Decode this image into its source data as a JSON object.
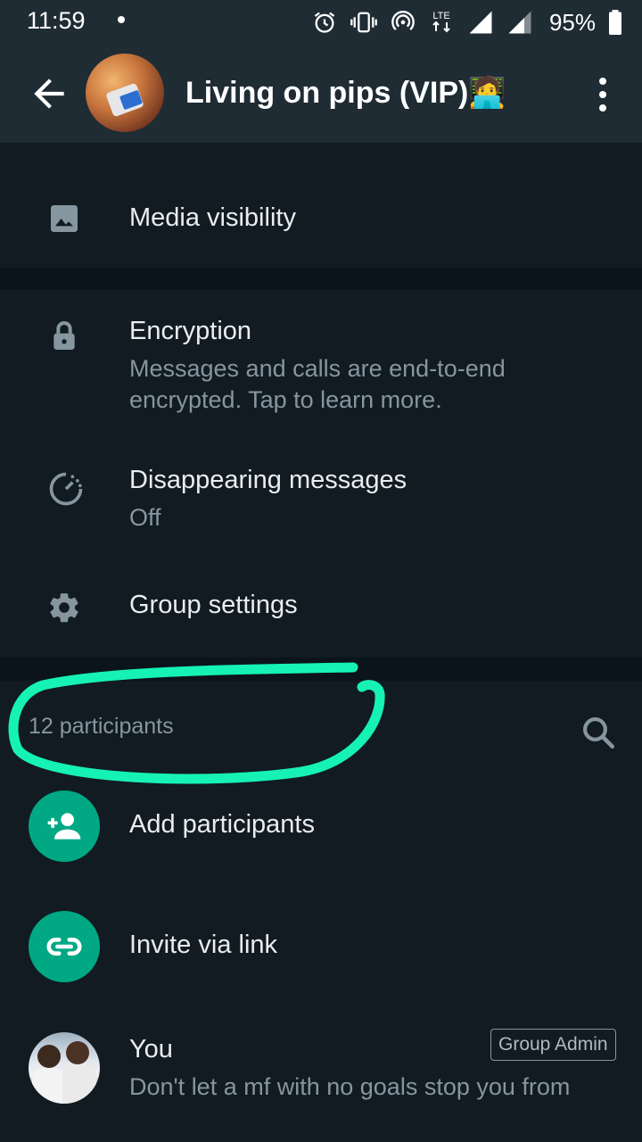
{
  "status_bar": {
    "time": "11:59",
    "network": "LTE",
    "battery": "95%",
    "icons": [
      "notification-dot-icon",
      "alarm-icon",
      "vibrate-icon",
      "hotspot-icon",
      "lte-icon",
      "signal-icon",
      "signal-icon",
      "battery-icon"
    ]
  },
  "header": {
    "title": "Living on pips (VIP)🧑‍💻",
    "back_icon": "back-arrow-icon",
    "menu_icon": "more-vert-icon"
  },
  "settings": {
    "media_visibility": "Media visibility",
    "encryption_title": "Encryption",
    "encryption_sub": "Messages and calls are end-to-end encrypted. Tap to learn more.",
    "disappearing_title": "Disappearing messages",
    "disappearing_sub": "Off",
    "group_settings": "Group settings"
  },
  "participants": {
    "count_label": "12 participants",
    "add_label": "Add participants",
    "invite_label": "Invite via link",
    "members": [
      {
        "name": "You",
        "badge": "Group Admin",
        "status": "Don't let a mf with no goals stop you from"
      }
    ]
  },
  "colors": {
    "background": "#111b21",
    "appbar": "#1f2c34",
    "accent": "#00a884",
    "highlight_scribble": "#16f2b6",
    "secondary_text": "#8696a0"
  }
}
